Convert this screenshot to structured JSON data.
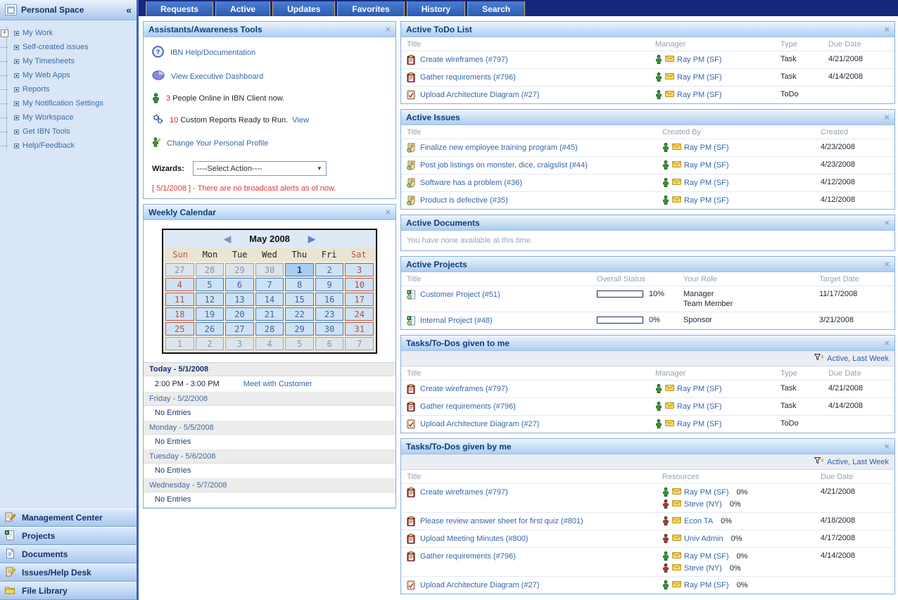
{
  "ui": {
    "close_glyph": "×",
    "collapse_glyph": "«",
    "dropdown_glyph": "▼",
    "prev_glyph": "◀",
    "next_glyph": "▶"
  },
  "colors": {
    "accent_blue": "#2b5cb4",
    "link_blue": "#3466ad",
    "alert_red": "#e03636",
    "count_red": "#cc2222",
    "presence_online_green": "#1fa51f",
    "presence_busy_red": "#c03028",
    "panel_header_blue": "#aecdf0"
  },
  "sidebar": {
    "title": "Personal Space",
    "items": [
      {
        "label": "My Work",
        "exp": "+"
      },
      {
        "label": "Self-created issues"
      },
      {
        "label": "My Timesheets"
      },
      {
        "label": "My Web Apps"
      },
      {
        "label": "Reports"
      },
      {
        "label": "My Notification Settings"
      },
      {
        "label": "My Workspace"
      },
      {
        "label": "Get IBN Tools"
      },
      {
        "label": "Help/Feedback"
      }
    ],
    "bottom_items": [
      {
        "label": "Management Center",
        "icon": "management"
      },
      {
        "label": "Projects",
        "icon": "projects"
      },
      {
        "label": "Documents",
        "icon": "documents"
      },
      {
        "label": "Issues/Help Desk",
        "icon": "issues"
      },
      {
        "label": "File Library",
        "icon": "library"
      }
    ]
  },
  "tabs": [
    "Requests",
    "Active",
    "Updates",
    "Favorites",
    "History",
    "Search"
  ],
  "assistants": {
    "title": "Assistants/Awareness Tools",
    "help_link": "IBN Help/Documentation",
    "dashboard_link": "View Executive Dashboard",
    "people_online_count": "3",
    "people_online_text": "People Online in IBN Client now.",
    "reports_count": "10",
    "reports_text": "Custom Reports Ready to Run.",
    "reports_view_label": "View",
    "profile_link": "Change Your Personal Profile",
    "wizards_label": "Wizards:",
    "wizards_selected": "----Select Action----",
    "alert": "[ 5/1/2008 ] - There are no broadcast alerts as of now."
  },
  "calendar": {
    "title": "Weekly Calendar",
    "month": "May 2008",
    "day_names": [
      "Sun",
      "Mon",
      "Tue",
      "Wed",
      "Thu",
      "Fri",
      "Sat"
    ],
    "cells": [
      {
        "d": "27",
        "t": "out"
      },
      {
        "d": "28",
        "t": "out"
      },
      {
        "d": "29",
        "t": "out"
      },
      {
        "d": "30",
        "t": "out"
      },
      {
        "d": "1",
        "t": "today"
      },
      {
        "d": "2",
        "t": "wd"
      },
      {
        "d": "3",
        "t": "we"
      },
      {
        "d": "4",
        "t": "we"
      },
      {
        "d": "5",
        "t": "wd"
      },
      {
        "d": "6",
        "t": "wd"
      },
      {
        "d": "7",
        "t": "wd"
      },
      {
        "d": "8",
        "t": "wd"
      },
      {
        "d": "9",
        "t": "wd"
      },
      {
        "d": "10",
        "t": "we"
      },
      {
        "d": "11",
        "t": "we"
      },
      {
        "d": "12",
        "t": "wd"
      },
      {
        "d": "13",
        "t": "wd"
      },
      {
        "d": "14",
        "t": "wd"
      },
      {
        "d": "15",
        "t": "wd"
      },
      {
        "d": "16",
        "t": "wd"
      },
      {
        "d": "17",
        "t": "we"
      },
      {
        "d": "18",
        "t": "we"
      },
      {
        "d": "19",
        "t": "wd"
      },
      {
        "d": "20",
        "t": "wd"
      },
      {
        "d": "21",
        "t": "wd"
      },
      {
        "d": "22",
        "t": "wd"
      },
      {
        "d": "23",
        "t": "wd"
      },
      {
        "d": "24",
        "t": "we"
      },
      {
        "d": "25",
        "t": "we"
      },
      {
        "d": "26",
        "t": "wd"
      },
      {
        "d": "27",
        "t": "wd"
      },
      {
        "d": "28",
        "t": "wd"
      },
      {
        "d": "29",
        "t": "wd"
      },
      {
        "d": "30",
        "t": "wd"
      },
      {
        "d": "31",
        "t": "we"
      },
      {
        "d": "1",
        "t": "out"
      },
      {
        "d": "2",
        "t": "out"
      },
      {
        "d": "3",
        "t": "out"
      },
      {
        "d": "4",
        "t": "out"
      },
      {
        "d": "5",
        "t": "out"
      },
      {
        "d": "6",
        "t": "out"
      },
      {
        "d": "7",
        "t": "out"
      }
    ],
    "agenda": [
      {
        "label": "Today - 5/1/2008",
        "today": "true",
        "entries": [
          {
            "time": "2:00 PM - 3:00 PM",
            "event": "Meet with Customer"
          }
        ]
      },
      {
        "label": "Friday - 5/2/2008",
        "empty": "No Entries",
        "entries": []
      },
      {
        "label": "Monday - 5/5/2008",
        "empty": "No Entries",
        "entries": []
      },
      {
        "label": "Tuesday - 5/6/2008",
        "empty": "No Entries",
        "entries": []
      },
      {
        "label": "Wednesday - 5/7/2008",
        "empty": "No Entries",
        "entries": []
      }
    ]
  },
  "panels": {
    "todo": {
      "title": "Active ToDo List",
      "headers": {
        "title": "Title",
        "manager": "Manager",
        "type": "Type",
        "due": "Due Date"
      },
      "rows": [
        {
          "icon": "task",
          "title": "Create wireframes (#797)",
          "presence": "online",
          "manager": "Ray PM (SF)",
          "type": "Task",
          "due": "4/21/2008"
        },
        {
          "icon": "task",
          "title": "Gather requirements (#796)",
          "presence": "online",
          "manager": "Ray PM (SF)",
          "type": "Task",
          "due": "4/14/2008"
        },
        {
          "icon": "todo",
          "title": "Upload Architecture Diagram (#27)",
          "presence": "online",
          "manager": "Ray PM (SF)",
          "type": "ToDo"
        }
      ]
    },
    "issues": {
      "title": "Active Issues",
      "headers": {
        "title": "Title",
        "created_by": "Created By",
        "created": "Created"
      },
      "rows": [
        {
          "icon": "issue",
          "title": "Finalize new employee training program (#45)",
          "presence": "online",
          "created_by": "Ray PM (SF)",
          "created": "4/23/2008"
        },
        {
          "icon": "issue",
          "title": "Post job listings on monster, dice, craigslist (#44)",
          "presence": "online",
          "created_by": "Ray PM (SF)",
          "created": "4/23/2008"
        },
        {
          "icon": "issue",
          "title": "Software has a problem (#36)",
          "presence": "online",
          "created_by": "Ray PM (SF)",
          "created": "4/12/2008"
        },
        {
          "icon": "issue",
          "title": "Product is defective (#35)",
          "presence": "online",
          "created_by": "Ray PM (SF)",
          "created": "4/12/2008"
        }
      ]
    },
    "documents": {
      "title": "Active Documents",
      "empty_text": "You have none available at this time."
    },
    "projects": {
      "title": "Active Projects",
      "headers": {
        "title": "Title",
        "status": "Overall Status",
        "role": "Your Role",
        "target": "Target Date"
      },
      "rows": [
        {
          "icon": "project",
          "title": "Customer Project (#51)",
          "pct": "10%",
          "roles": [
            "Manager",
            "Team Member"
          ],
          "target": "11/17/2008"
        },
        {
          "icon": "project",
          "title": "Internal Project (#48)",
          "pct": "0%",
          "roles": [
            "Sponsor"
          ],
          "target": "3/21/2008"
        }
      ]
    },
    "given_to_me": {
      "title": "Tasks/To-Dos given to me",
      "filter": "Active, Last Week",
      "headers": {
        "title": "Title",
        "manager": "Manager",
        "type": "Type",
        "due": "Due Date"
      },
      "rows": [
        {
          "icon": "task",
          "title": "Create wireframes (#797)",
          "presence": "online",
          "manager": "Ray PM (SF)",
          "type": "Task",
          "due": "4/21/2008"
        },
        {
          "icon": "task",
          "title": "Gather requirements (#796)",
          "presence": "online",
          "manager": "Ray PM (SF)",
          "type": "Task",
          "due": "4/14/2008"
        },
        {
          "icon": "todo",
          "title": "Upload Architecture Diagram (#27)",
          "presence": "online",
          "manager": "Ray PM (SF)",
          "type": "ToDo"
        }
      ]
    },
    "given_by_me": {
      "title": "Tasks/To-Dos given by me",
      "filter": "Active, Last Week",
      "headers": {
        "title": "Title",
        "resources": "Resources",
        "due": "Due Date"
      },
      "rows": [
        {
          "icon": "task",
          "title": "Create wireframes (#797)",
          "due": "4/21/2008",
          "resources": [
            {
              "presence": "online",
              "name": "Ray PM (SF)",
              "pct": "0%"
            },
            {
              "presence": "busy",
              "name": "Steve (NY)",
              "pct": "0%"
            }
          ]
        },
        {
          "icon": "task",
          "title": "Please review answer sheet for first quiz (#801)",
          "due": "4/18/2008",
          "resources": [
            {
              "presence": "busy",
              "name": "Econ TA",
              "pct": "0%"
            }
          ]
        },
        {
          "icon": "task",
          "title": "Upload Meeting Minutes (#800)",
          "due": "4/17/2008",
          "resources": [
            {
              "presence": "busy",
              "name": "Univ Admin",
              "pct": "0%"
            }
          ]
        },
        {
          "icon": "task",
          "title": "Gather requirements (#796)",
          "due": "4/14/2008",
          "resources": [
            {
              "presence": "online",
              "name": "Ray PM (SF)",
              "pct": "0%"
            },
            {
              "presence": "busy",
              "name": "Steve (NY)",
              "pct": "0%"
            }
          ]
        },
        {
          "icon": "todo",
          "title": "Upload Architecture Diagram (#27)",
          "resources": [
            {
              "presence": "online",
              "name": "Ray PM (SF)",
              "pct": "0%"
            }
          ]
        }
      ]
    }
  }
}
